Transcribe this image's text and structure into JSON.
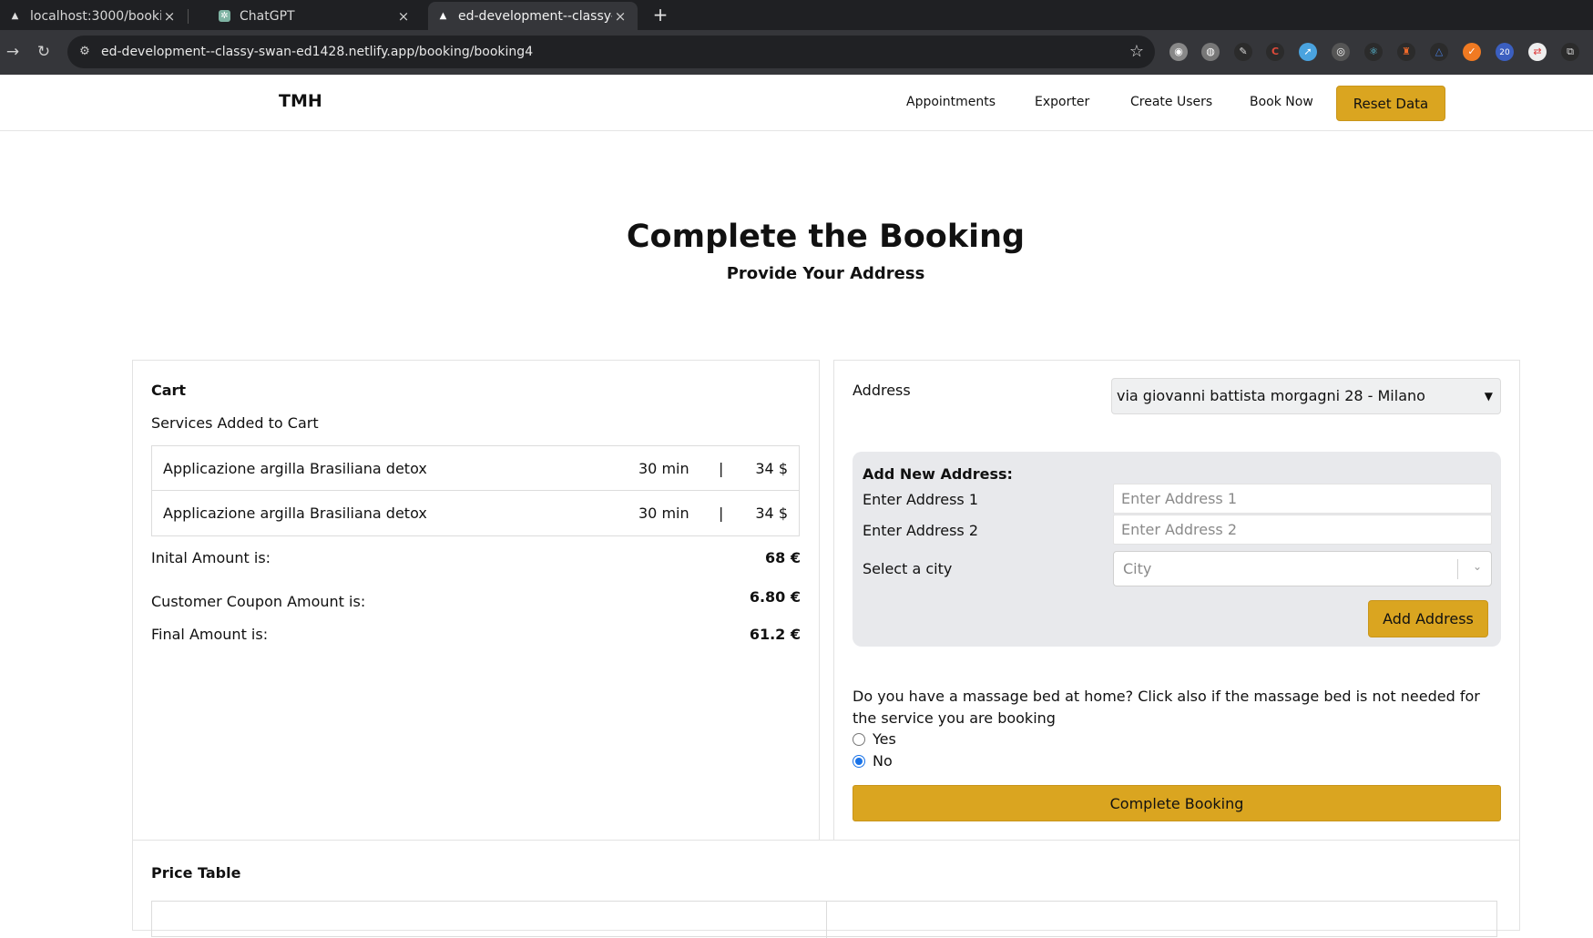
{
  "browser": {
    "tabs": [
      {
        "title": "localhost:3000/booking/",
        "close": "×"
      },
      {
        "title": "ChatGPT",
        "close": "×"
      },
      {
        "title": "ed-development--classy-",
        "close": "×"
      }
    ],
    "new_tab": "+",
    "url": "ed-development--classy-swan-ed1428.netlify.app/booking/booking4",
    "extension_badge": "20"
  },
  "header": {
    "brand": "TMH",
    "nav": [
      "Appointments",
      "Exporter",
      "Create Users",
      "Book Now"
    ],
    "reset_label": "Reset Data",
    "accent": "#daa520"
  },
  "page": {
    "title": "Complete the Booking",
    "subtitle": "Provide Your Address"
  },
  "cart": {
    "title": "Cart",
    "subtitle": "Services Added to Cart",
    "services": [
      {
        "name": "Applicazione argilla Brasiliana detox",
        "duration": "30 min",
        "sep": "|",
        "price": "34 $"
      },
      {
        "name": "Applicazione argilla Brasiliana detox",
        "duration": "30 min",
        "sep": "|",
        "price": "34 $"
      }
    ],
    "initial_label": "Inital Amount is:",
    "initial_value": "68 €",
    "coupon_label": "Customer Coupon Amount is:",
    "coupon_value": "6.80 €",
    "final_label": "Final Amount is:",
    "final_value": "61.2 €"
  },
  "address": {
    "label": "Address",
    "selected": "via giovanni battista morgagni 28 - Milano",
    "new_title": "Add New Address:",
    "addr1_label": "Enter Address 1",
    "addr1_placeholder": "Enter Address 1",
    "addr2_label": "Enter Address 2",
    "addr2_placeholder": "Enter Address 2",
    "city_label": "Select a city",
    "city_placeholder": "City",
    "add_label": "Add Address",
    "massage_question": "Do you have a massage bed at home? Click also if the massage bed is not needed for the service you are booking",
    "options": [
      "Yes",
      "No"
    ],
    "selected_option": "No",
    "complete_label": "Complete Booking"
  },
  "price_table": {
    "title": "Price Table"
  }
}
